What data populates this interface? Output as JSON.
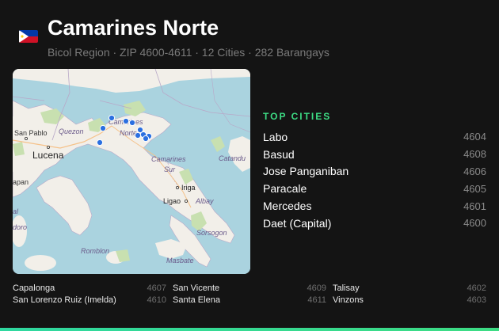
{
  "header": {
    "flag_icon": "philippines-flag-icon",
    "title": "Camarines Norte",
    "subtitle": "Bicol Region · ZIP 4600-4611 · 12 Cities · 282 Barangays"
  },
  "map": {
    "labels": {
      "san_pablo": "San Pablo",
      "quezon": "Quezon",
      "lucena": "Lucena",
      "camarines": "Camarines",
      "norte": "Norte",
      "camarines_sur_1": "Camarines",
      "camarines_sur_2": "Sur",
      "catanduanes": "Catandu",
      "iriga": "Iriga",
      "ligao": "Ligao",
      "albay": "Albay",
      "sorsogon": "Sorsogon",
      "romblon": "Romblon",
      "masbate": "Masbate",
      "apan": "apan",
      "al": "al",
      "doro": "doro"
    }
  },
  "top_cities": {
    "label": "TOP CITIES",
    "items": [
      {
        "name": "Labo",
        "zip": "4604"
      },
      {
        "name": "Basud",
        "zip": "4608"
      },
      {
        "name": "Jose Panganiban",
        "zip": "4606"
      },
      {
        "name": "Paracale",
        "zip": "4605"
      },
      {
        "name": "Mercedes",
        "zip": "4601"
      },
      {
        "name": "Daet (Capital)",
        "zip": "4600"
      }
    ]
  },
  "other_cities": {
    "col1": [
      {
        "name": "Capalonga",
        "zip": "4607"
      },
      {
        "name": "San Lorenzo Ruiz (Imelda)",
        "zip": "4610"
      }
    ],
    "col2": [
      {
        "name": "San Vicente",
        "zip": "4609"
      },
      {
        "name": "Santa Elena",
        "zip": "4611"
      }
    ],
    "col3": [
      {
        "name": "Talisay",
        "zip": "4602"
      },
      {
        "name": "Vinzons",
        "zip": "4603"
      }
    ]
  },
  "colors": {
    "accent": "#3ddc84",
    "background": "#141414",
    "marker": "#2b6fe0"
  }
}
